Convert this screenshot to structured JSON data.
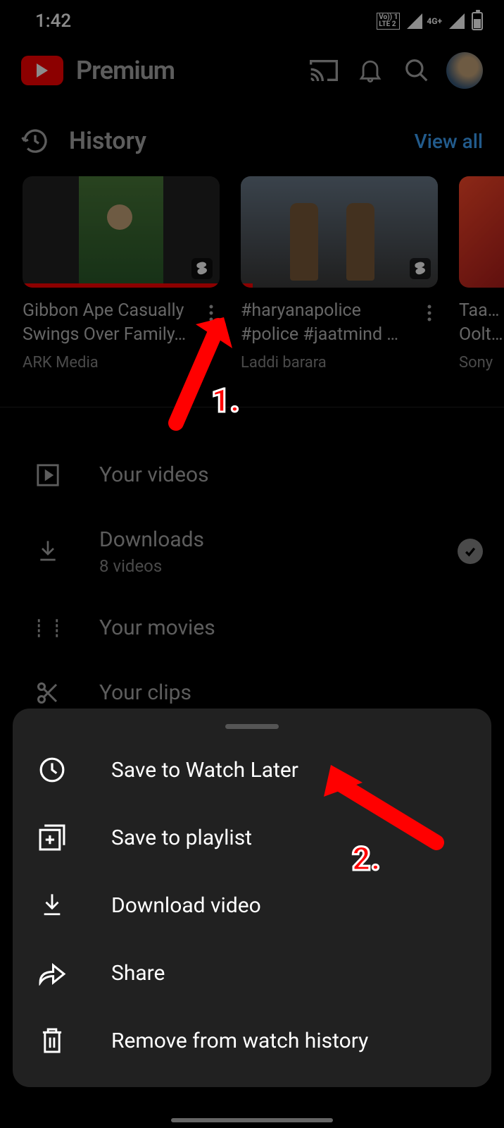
{
  "status": {
    "time": "1:42",
    "volte": "Vo)) 1\nLTE 2",
    "net": "4G+"
  },
  "header": {
    "brand": "Premium"
  },
  "history": {
    "title": "History",
    "view_all": "View all",
    "items": [
      {
        "title": "Gibbon Ape Casually Swings Over Family…",
        "channel": "ARK Media",
        "progress": 100
      },
      {
        "title": "#haryanapolice #police #jaatmind …",
        "channel": "Laddi barara",
        "progress": 6
      },
      {
        "title": "Taa… Oolt…",
        "channel": "Sony",
        "progress": 3
      }
    ]
  },
  "library": {
    "your_videos": "Your videos",
    "downloads": {
      "label": "Downloads",
      "sub": "8 videos"
    },
    "your_movies": "Your movies",
    "your_clips": "Your clips"
  },
  "sheet": {
    "watch_later": "Save to Watch Later",
    "save_playlist": "Save to playlist",
    "download": "Download video",
    "share": "Share",
    "remove_history": "Remove from watch history"
  },
  "annotations": {
    "n1": "1.",
    "n2": "2."
  }
}
